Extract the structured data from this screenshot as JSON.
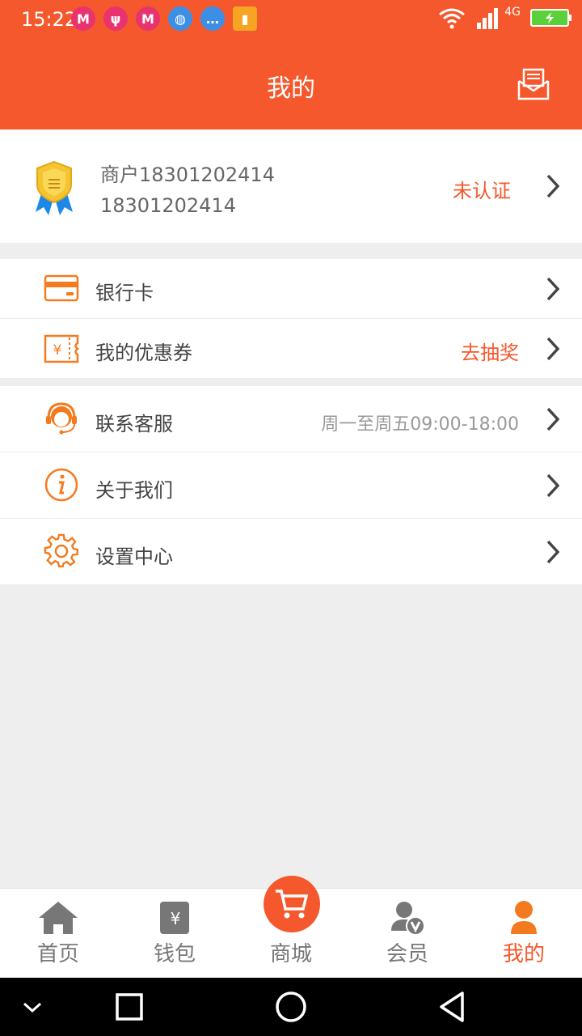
{
  "status_bar": {
    "time": "15:22",
    "network": "4G"
  },
  "header": {
    "title": "我的",
    "icon": "message-icon"
  },
  "profile": {
    "name": "商户18301202414",
    "phone": "18301202414",
    "status": "未认证",
    "status_color": "#f4582c",
    "icon": "medal-badge-icon"
  },
  "section1": {
    "items": [
      {
        "label": "银行卡",
        "icon": "bank-card-icon",
        "right": ""
      },
      {
        "label": "我的优惠券",
        "icon": "coupon-icon",
        "right": "去抽奖"
      }
    ]
  },
  "section2": {
    "items": [
      {
        "label": "联系客服",
        "icon": "customer-service-icon",
        "right": "周一至周五09:00-18:00"
      },
      {
        "label": "关于我们",
        "icon": "info-icon",
        "right": ""
      },
      {
        "label": "设置中心",
        "icon": "settings-icon",
        "right": ""
      }
    ]
  },
  "tabs": [
    {
      "label": "首页",
      "icon": "home-icon"
    },
    {
      "label": "钱包",
      "icon": "wallet-icon"
    },
    {
      "label": "商城",
      "icon": "cart-icon"
    },
    {
      "label": "会员",
      "icon": "member-icon"
    },
    {
      "label": "我的",
      "icon": "user-icon",
      "active": true
    }
  ],
  "colors": {
    "brand": "#f4582c",
    "background": "#eeeeee"
  }
}
